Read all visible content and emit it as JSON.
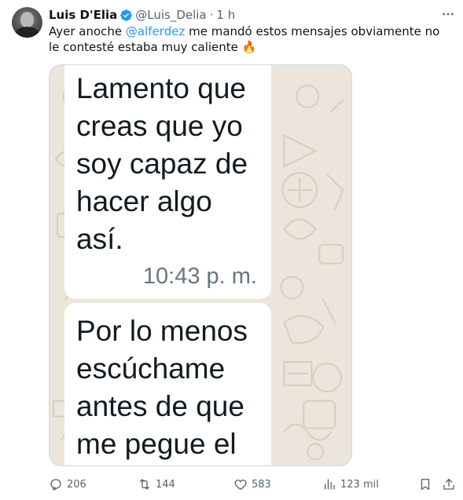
{
  "author": {
    "name": "Luis D'Elia",
    "handle": "@Luis_Delia",
    "separator": "·",
    "time": "1 h"
  },
  "tweet": {
    "text_before": "Ayer anoche ",
    "mention": "@alferdez",
    "text_after": " me mandó estos mensajes obviamente no le contesté estaba muy caliente",
    "emoji": "🔥"
  },
  "media": {
    "messages": [
      {
        "text": "Lamento que\ncreas que yo\nsoy capaz de\nhacer algo\nasí.",
        "time": "10:43 p. m."
      },
      {
        "text": "Por lo menos\nescúchame\nantes de que\nme pegue el",
        "time": ""
      }
    ]
  },
  "actions": {
    "replies": "206",
    "reposts": "144",
    "likes": "583",
    "views": "123 mil"
  },
  "icons": {
    "avatar": "profile-photo",
    "verified": "verified-badge-icon",
    "more": "more-icon",
    "reply": "reply-icon",
    "repost": "repost-icon",
    "like": "heart-icon",
    "views": "views-icon",
    "bookmark": "bookmark-icon",
    "share": "share-icon"
  },
  "colors": {
    "accent": "#1d9bf0",
    "secondary_text": "#536471",
    "chat_background": "#ece5dc"
  }
}
